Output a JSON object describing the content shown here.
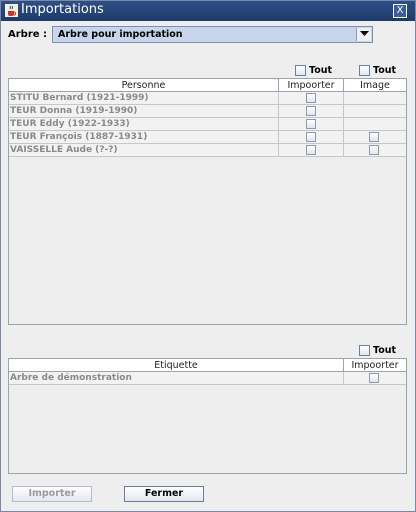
{
  "window": {
    "title": "Importations",
    "close_glyph": "X"
  },
  "tree": {
    "label": "Arbre :",
    "selected": "Arbre pour importation"
  },
  "persons": {
    "all_import_label": "Tout",
    "all_image_label": "Tout",
    "columns": [
      "Personne",
      "Impoorter",
      "Image"
    ],
    "rows": [
      {
        "name": "STITU Bernard (1921-1999)",
        "has_image": false
      },
      {
        "name": "TEUR Donna (1919-1990)",
        "has_image": false
      },
      {
        "name": "TEUR Eddy (1922-1933)",
        "has_image": false
      },
      {
        "name": "TEUR François (1887-1931)",
        "has_image": true
      },
      {
        "name": "VAISSELLE Aude (?-?)",
        "has_image": true
      }
    ]
  },
  "labels": {
    "all_label": "Tout",
    "columns": [
      "Etiquette",
      "Impoorter"
    ],
    "rows": [
      {
        "name": "Arbre de démonstration"
      }
    ]
  },
  "buttons": {
    "import": "Importer",
    "close": "Fermer"
  },
  "colors": {
    "titlebar": "#1d3a6b",
    "combo_bg": "#c9d5ea",
    "disabled_text": "#8a8a8a"
  }
}
